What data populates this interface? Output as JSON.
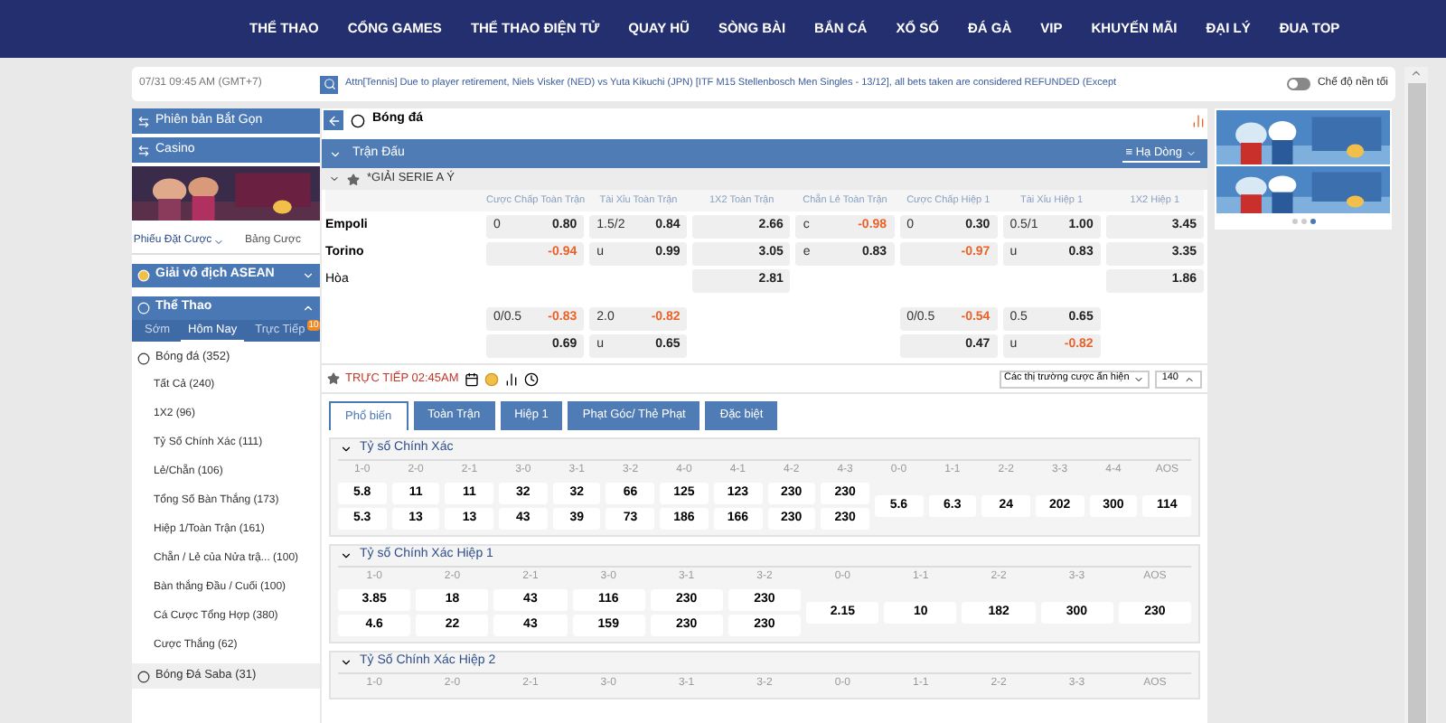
{
  "nav": {
    "items": [
      "THỂ THAO",
      "CỔNG GAMES",
      "THỂ THAO ĐIỆN TỬ",
      "QUAY HŨ",
      "SÒNG BÀI",
      "BẮN CÁ",
      "XỔ SỐ",
      "ĐÁ GÀ",
      "VIP",
      "KHUYẾN MÃI",
      "ĐẠI LÝ",
      "ĐUA TOP"
    ]
  },
  "ticker": {
    "date": "07/31 09:45 AM (GMT+7)",
    "message": "Attn[Tennis] Due to player retirement, Niels Visker (NED) vs Yuta Kikuchi (JPN) [ITF M15 Stellenbosch Men Singles - 13/12], all bets taken are considered REFUNDED (Except",
    "dark_mode": {
      "label": "Chế độ nền tối",
      "on": false
    }
  },
  "sidebar": {
    "promos": [
      "Phiên bản Bắt Gọn",
      "Casino"
    ],
    "bet_tabs": [
      {
        "label": "Phiếu Đặt Cược",
        "selected": true
      },
      {
        "label": "Bảng Cược",
        "selected": false
      }
    ],
    "asean": {
      "label": "Giải vô địch ASEAN",
      "expanded": false
    },
    "sports": {
      "label": "Thể Thao",
      "expanded": true,
      "tabs": [
        {
          "label": "Sớm",
          "selected": false
        },
        {
          "label": "Hôm Nay",
          "selected": true
        },
        {
          "label": "Trực Tiếp",
          "selected": false,
          "badge": "10"
        }
      ],
      "items": [
        {
          "label": "Bóng đá (352)",
          "children": [
            "Tất Cả (240)",
            "1X2 (96)",
            "Tỷ Số Chính Xác (111)",
            "Lẻ/Chẵn (106)",
            "Tổng Số Bàn Thắng (173)",
            "Hiệp 1/Toàn Trận (161)",
            "Chẵn / Lẻ của Nửa trậ... (100)",
            "Bàn thắng Đầu / Cuối (100)",
            "Cá Cược Tổng Hợp (380)",
            "Cược Thắng (62)"
          ]
        },
        {
          "label": "Bóng Đá Saba (31)"
        }
      ]
    }
  },
  "main": {
    "sport": "Bóng đá",
    "bar_title": "Trận Đấu",
    "bar_dropdown": "≡ Hạ Dòng",
    "league": "*GIẢI SERIE A Ý",
    "columns": [
      "Cược Chấp Toàn Trận",
      "Tài Xỉu Toàn Trận",
      "1X2 Toàn Trận",
      "Chẵn Lẻ Toàn Trận",
      "Cược Chấp Hiệp 1",
      "Tài Xỉu Hiệp 1",
      "1X2 Hiệp 1"
    ],
    "rows": [
      {
        "team": "Empoli",
        "cells": [
          {
            "line": "0",
            "price": "0.80",
            "negative": false
          },
          {
            "line": "1.5/2",
            "price": "0.84",
            "negative": false
          },
          {
            "price": "2.66",
            "negative": false
          },
          {
            "line": "c",
            "price": "-0.98",
            "negative": true
          },
          {
            "line": "0",
            "price": "0.30",
            "negative": false
          },
          {
            "line": "0.5/1",
            "price": "1.00",
            "negative": false
          },
          {
            "price": "3.45",
            "negative": false
          }
        ]
      },
      {
        "team": "Torino",
        "cells": [
          {
            "price": "-0.94",
            "negative": true
          },
          {
            "line": "u",
            "price": "0.99",
            "negative": false
          },
          {
            "price": "3.05",
            "negative": false
          },
          {
            "line": "e",
            "price": "0.83",
            "negative": false
          },
          {
            "price": "-0.97",
            "negative": true
          },
          {
            "line": "u",
            "price": "0.83",
            "negative": false
          },
          {
            "price": "3.35",
            "negative": false
          }
        ]
      },
      {
        "team": "Hòa",
        "cells": [
          null,
          null,
          {
            "price": "2.81",
            "negative": false
          },
          null,
          null,
          null,
          {
            "price": "1.86",
            "negative": false
          }
        ]
      },
      {
        "cells": [
          {
            "line": "0/0.5",
            "price": "-0.83",
            "negative": true
          },
          {
            "line": "2.0",
            "price": "-0.82",
            "negative": true
          },
          null,
          null,
          {
            "line": "0/0.5",
            "price": "-0.54",
            "negative": true
          },
          {
            "line": "0.5",
            "price": "0.65",
            "negative": false
          },
          null
        ]
      },
      {
        "cells": [
          {
            "price": "0.69",
            "negative": false
          },
          {
            "line": "u",
            "price": "0.65",
            "negative": false
          },
          null,
          null,
          {
            "price": "0.47",
            "negative": false
          },
          {
            "line": "u",
            "price": "-0.82",
            "negative": true
          },
          null
        ]
      }
    ],
    "match": {
      "status": "TRỰC TIẾP 02:45AM",
      "markets_select": "Các thị trường cược ẩn hiện",
      "count": "140"
    },
    "tabs": [
      {
        "label": "Phổ biến",
        "selected": true
      },
      {
        "label": "Toàn Trận",
        "selected": false
      },
      {
        "label": "Hiệp 1",
        "selected": false
      },
      {
        "label": "Phạt Góc/ Thẻ Phạt",
        "selected": false
      },
      {
        "label": "Đặc biệt",
        "selected": false
      }
    ],
    "sections": [
      {
        "title": "Tỷ số Chính Xác",
        "expanded": true,
        "labels": [
          "1-0",
          "2-0",
          "2-1",
          "3-0",
          "3-1",
          "3-2",
          "4-0",
          "4-1",
          "4-2",
          "4-3",
          "0-0",
          "1-1",
          "2-2",
          "3-3",
          "4-4",
          "AOS"
        ],
        "home": [
          "5.8",
          "11",
          "11",
          "32",
          "32",
          "66",
          "125",
          "123",
          "230",
          "230"
        ],
        "away": [
          "5.3",
          "13",
          "13",
          "43",
          "39",
          "73",
          "186",
          "166",
          "230",
          "230"
        ],
        "draw": [
          "5.6",
          "6.3",
          "24",
          "202",
          "300",
          "114"
        ]
      },
      {
        "title": "Tỷ số Chính Xác Hiệp 1",
        "expanded": true,
        "labels": [
          "1-0",
          "2-0",
          "2-1",
          "3-0",
          "3-1",
          "3-2",
          "0-0",
          "1-1",
          "2-2",
          "3-3",
          "AOS"
        ],
        "home": [
          "3.85",
          "18",
          "43",
          "116",
          "230",
          "230"
        ],
        "away": [
          "4.6",
          "22",
          "43",
          "159",
          "230",
          "230"
        ],
        "draw": [
          "2.15",
          "10",
          "182",
          "300",
          "230"
        ]
      },
      {
        "title": "Tỷ Số Chính Xác Hiệp 2",
        "expanded": true,
        "labels": [
          "1-0",
          "2-0",
          "2-1",
          "3-0",
          "3-1",
          "3-2",
          "0-0",
          "1-1",
          "2-2",
          "3-3",
          "AOS"
        ]
      }
    ]
  }
}
